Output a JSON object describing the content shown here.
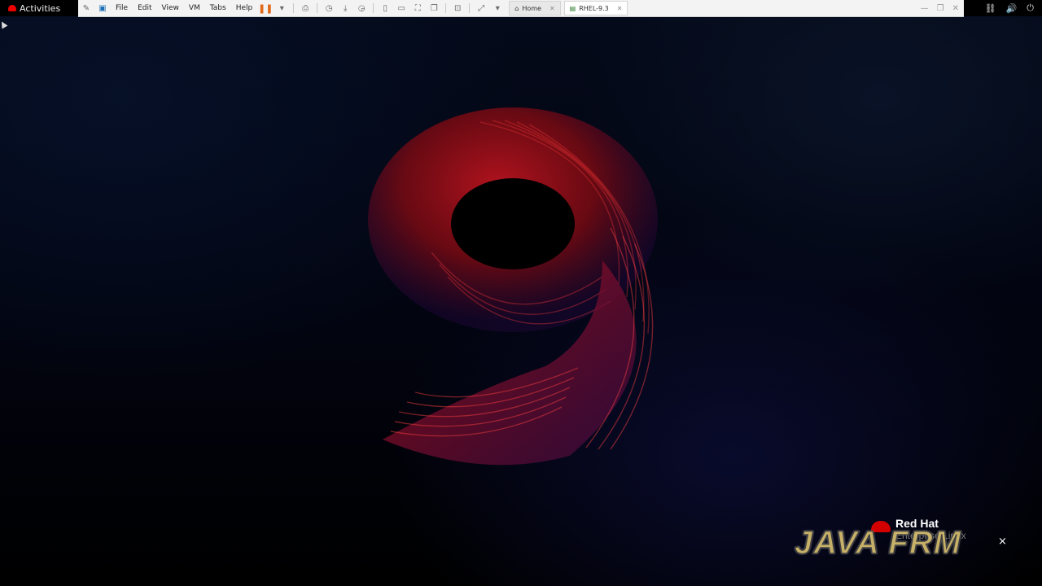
{
  "topbar": {
    "activities_label": "Activities",
    "tray": {
      "network_icon": "network-icon",
      "volume_icon": "volume-icon",
      "power_icon": "power-icon"
    }
  },
  "vmware": {
    "menu": [
      "File",
      "Edit",
      "View",
      "VM",
      "Tabs",
      "Help"
    ],
    "tabs": [
      {
        "label": "Home",
        "active": false
      },
      {
        "label": "RHEL-9.3",
        "active": true
      }
    ]
  },
  "desktop": {
    "brand_line1": "Red Hat",
    "brand_line2": "Enterprise Linux",
    "watermark": "JAVA FRM",
    "watermark_close": "×"
  },
  "colors": {
    "accent_red": "#d40000",
    "vmware_pause": "#e06a1a",
    "background": "#020410"
  }
}
